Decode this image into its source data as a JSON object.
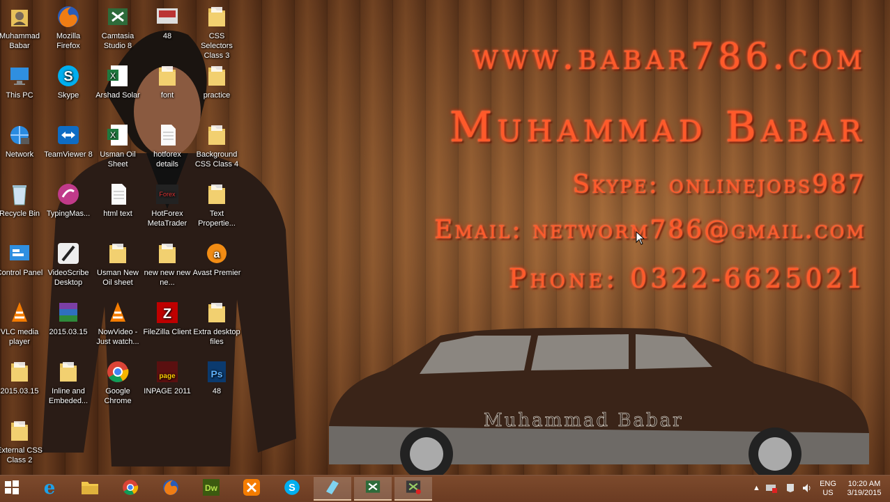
{
  "desktop": {
    "icons": [
      {
        "label": "Muhammad Babar",
        "icon": "user-folder-icon"
      },
      {
        "label": "Mozilla Firefox",
        "icon": "firefox-icon"
      },
      {
        "label": "Camtasia Studio 8",
        "icon": "camtasia-icon"
      },
      {
        "label": "48",
        "icon": "image-file-icon"
      },
      {
        "label": "CSS Selectors Class 3",
        "icon": "folder-icon"
      },
      {
        "label": "This PC",
        "icon": "this-pc-icon"
      },
      {
        "label": "Skype",
        "icon": "skype-icon"
      },
      {
        "label": "Arshad Solar",
        "icon": "excel-file-icon"
      },
      {
        "label": "font",
        "icon": "folder-icon"
      },
      {
        "label": "practice",
        "icon": "folder-icon"
      },
      {
        "label": "Network",
        "icon": "network-icon"
      },
      {
        "label": "TeamViewer 8",
        "icon": "teamviewer-icon"
      },
      {
        "label": "Usman Oil Sheet",
        "icon": "excel-file-icon"
      },
      {
        "label": "hotforex details",
        "icon": "document-icon"
      },
      {
        "label": "Background CSS Class 4",
        "icon": "folder-icon"
      },
      {
        "label": "Recycle Bin",
        "icon": "recycle-bin-icon"
      },
      {
        "label": "TypingMas...",
        "icon": "typingmaster-icon"
      },
      {
        "label": "html text",
        "icon": "document-icon"
      },
      {
        "label": "HotForex MetaTrader",
        "icon": "metatrader-icon"
      },
      {
        "label": "Text Propertie...",
        "icon": "folder-icon"
      },
      {
        "label": "Control Panel",
        "icon": "control-panel-icon"
      },
      {
        "label": "VideoScribe Desktop",
        "icon": "videoscribe-icon"
      },
      {
        "label": "Usman New Oil sheet",
        "icon": "folder-icon"
      },
      {
        "label": "new new new ne...",
        "icon": "folder-icon"
      },
      {
        "label": "Avast Premier",
        "icon": "avast-icon"
      },
      {
        "label": "VLC media player",
        "icon": "vlc-icon"
      },
      {
        "label": "2015.03.15",
        "icon": "rar-archive-icon"
      },
      {
        "label": "NowVideo - Just watch...",
        "icon": "vlc-icon"
      },
      {
        "label": "FileZilla Client",
        "icon": "filezilla-icon"
      },
      {
        "label": "Extra desktop files",
        "icon": "folder-icon"
      },
      {
        "label": "2015.03.15",
        "icon": "folder-icon"
      },
      {
        "label": "Inline and Embeded...",
        "icon": "folder-icon"
      },
      {
        "label": "Google Chrome",
        "icon": "chrome-icon"
      },
      {
        "label": "INPAGE 2011",
        "icon": "inpage-icon"
      },
      {
        "label": "48",
        "icon": "photoshop-file-icon"
      },
      {
        "label": "External CSS Class 2",
        "icon": "folder-icon"
      }
    ]
  },
  "wallpaper": {
    "website": "www.babar786.com",
    "name": "Muhammad Babar",
    "skype": "Skype: onlinejobs987",
    "email": "Email: networm786@gmail.com",
    "phone": "Phone: 0322-6625021",
    "car_text": "Muhammad Babar",
    "text_color": "#ff5a2a"
  },
  "taskbar": {
    "items": [
      {
        "icon": "windows-start-icon"
      },
      {
        "icon": "internet-explorer-icon"
      },
      {
        "icon": "file-explorer-icon"
      },
      {
        "icon": "chrome-icon"
      },
      {
        "icon": "firefox-icon"
      },
      {
        "icon": "dreamweaver-icon",
        "text": "Dw"
      },
      {
        "icon": "xampp-icon"
      },
      {
        "icon": "skype-icon"
      },
      {
        "icon": "app-icon"
      },
      {
        "icon": "camtasia-icon"
      },
      {
        "icon": "camtasia-recorder-icon"
      }
    ],
    "tray": {
      "language": "ENG",
      "region": "US",
      "time": "10:20 AM",
      "date": "3/19/2015"
    }
  }
}
